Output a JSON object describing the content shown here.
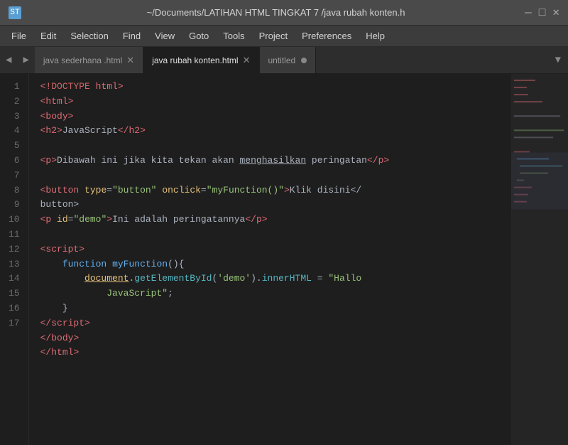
{
  "titlebar": {
    "icon": "ST",
    "title": "~/Documents/LATIHAN HTML TINGKAT 7 /java rubah konten.h",
    "minimize": "—",
    "maximize": "□",
    "close": "✕"
  },
  "menubar": {
    "items": [
      "File",
      "Edit",
      "Selection",
      "Find",
      "View",
      "Goto",
      "Tools",
      "Project",
      "Preferences",
      "Help"
    ]
  },
  "tabs": {
    "nav_left": "◀",
    "nav_right": "▶",
    "items": [
      {
        "label": "java sederhana .html",
        "active": false,
        "close": "✕"
      },
      {
        "label": "java rubah konten.html",
        "active": true,
        "close": "✕"
      },
      {
        "label": "untitled",
        "active": false,
        "dirty": true
      }
    ],
    "overflow": "▼"
  },
  "code": {
    "lines": [
      1,
      2,
      3,
      4,
      5,
      6,
      7,
      8,
      9,
      10,
      11,
      12,
      13,
      14,
      15,
      16,
      17
    ]
  }
}
